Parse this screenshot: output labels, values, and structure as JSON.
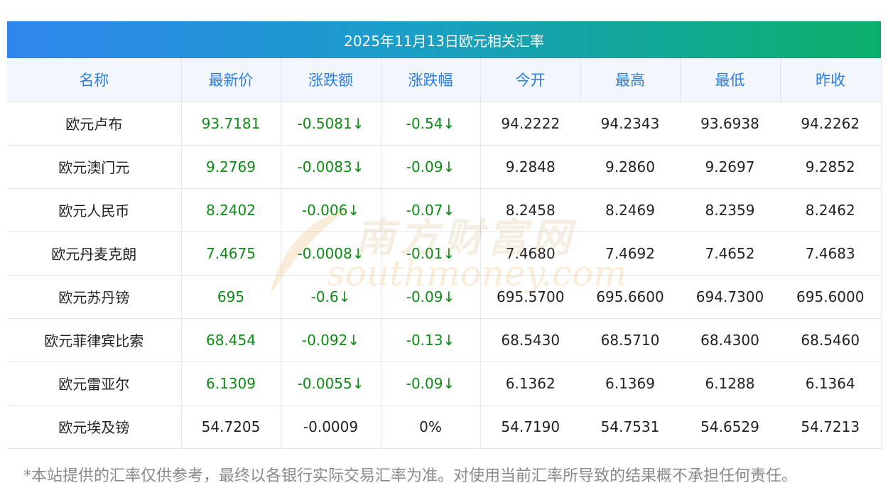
{
  "title": "2025年11月13日欧元相关汇率",
  "headers": [
    "名称",
    "最新价",
    "涨跌额",
    "涨跌幅",
    "今开",
    "最高",
    "最低",
    "昨收"
  ],
  "rows": [
    {
      "name": "欧元卢布",
      "latest": "93.7181",
      "change": "-0.5081↓",
      "pct": "-0.54↓",
      "open": "94.2222",
      "high": "94.2343",
      "low": "93.6938",
      "prev": "94.2262",
      "trend": "down"
    },
    {
      "name": "欧元澳门元",
      "latest": "9.2769",
      "change": "-0.0083↓",
      "pct": "-0.09↓",
      "open": "9.2848",
      "high": "9.2860",
      "low": "9.2697",
      "prev": "9.2852",
      "trend": "down"
    },
    {
      "name": "欧元人民币",
      "latest": "8.2402",
      "change": "-0.006↓",
      "pct": "-0.07↓",
      "open": "8.2458",
      "high": "8.2469",
      "low": "8.2359",
      "prev": "8.2462",
      "trend": "down"
    },
    {
      "name": "欧元丹麦克朗",
      "latest": "7.4675",
      "change": "-0.0008↓",
      "pct": "-0.01↓",
      "open": "7.4680",
      "high": "7.4692",
      "low": "7.4652",
      "prev": "7.4683",
      "trend": "down"
    },
    {
      "name": "欧元苏丹镑",
      "latest": "695",
      "change": "-0.6↓",
      "pct": "-0.09↓",
      "open": "695.5700",
      "high": "695.6600",
      "low": "694.7300",
      "prev": "695.6000",
      "trend": "down"
    },
    {
      "name": "欧元菲律宾比索",
      "latest": "68.454",
      "change": "-0.092↓",
      "pct": "-0.13↓",
      "open": "68.5430",
      "high": "68.5710",
      "low": "68.4300",
      "prev": "68.5460",
      "trend": "down"
    },
    {
      "name": "欧元雷亚尔",
      "latest": "6.1309",
      "change": "-0.0055↓",
      "pct": "-0.09↓",
      "open": "6.1362",
      "high": "6.1369",
      "low": "6.1288",
      "prev": "6.1364",
      "trend": "down"
    },
    {
      "name": "欧元埃及镑",
      "latest": "54.7205",
      "change": "-0.0009",
      "pct": "0%",
      "open": "54.7190",
      "high": "54.7531",
      "low": "54.6529",
      "prev": "54.7213",
      "trend": "flat"
    }
  ],
  "watermark": {
    "cn": "南方财富网",
    "en": "southmoney.com"
  },
  "footnote": "*本站提供的汇率仅供参考，最终以各银行实际交易汇率为准。对使用当前汇率所导致的结果概不承担任何责任。",
  "colors": {
    "header_text": "#2e7de0",
    "down": "#0e8a16",
    "title_gradient_start": "#2f86ee",
    "title_gradient_end": "#0ab06a"
  }
}
